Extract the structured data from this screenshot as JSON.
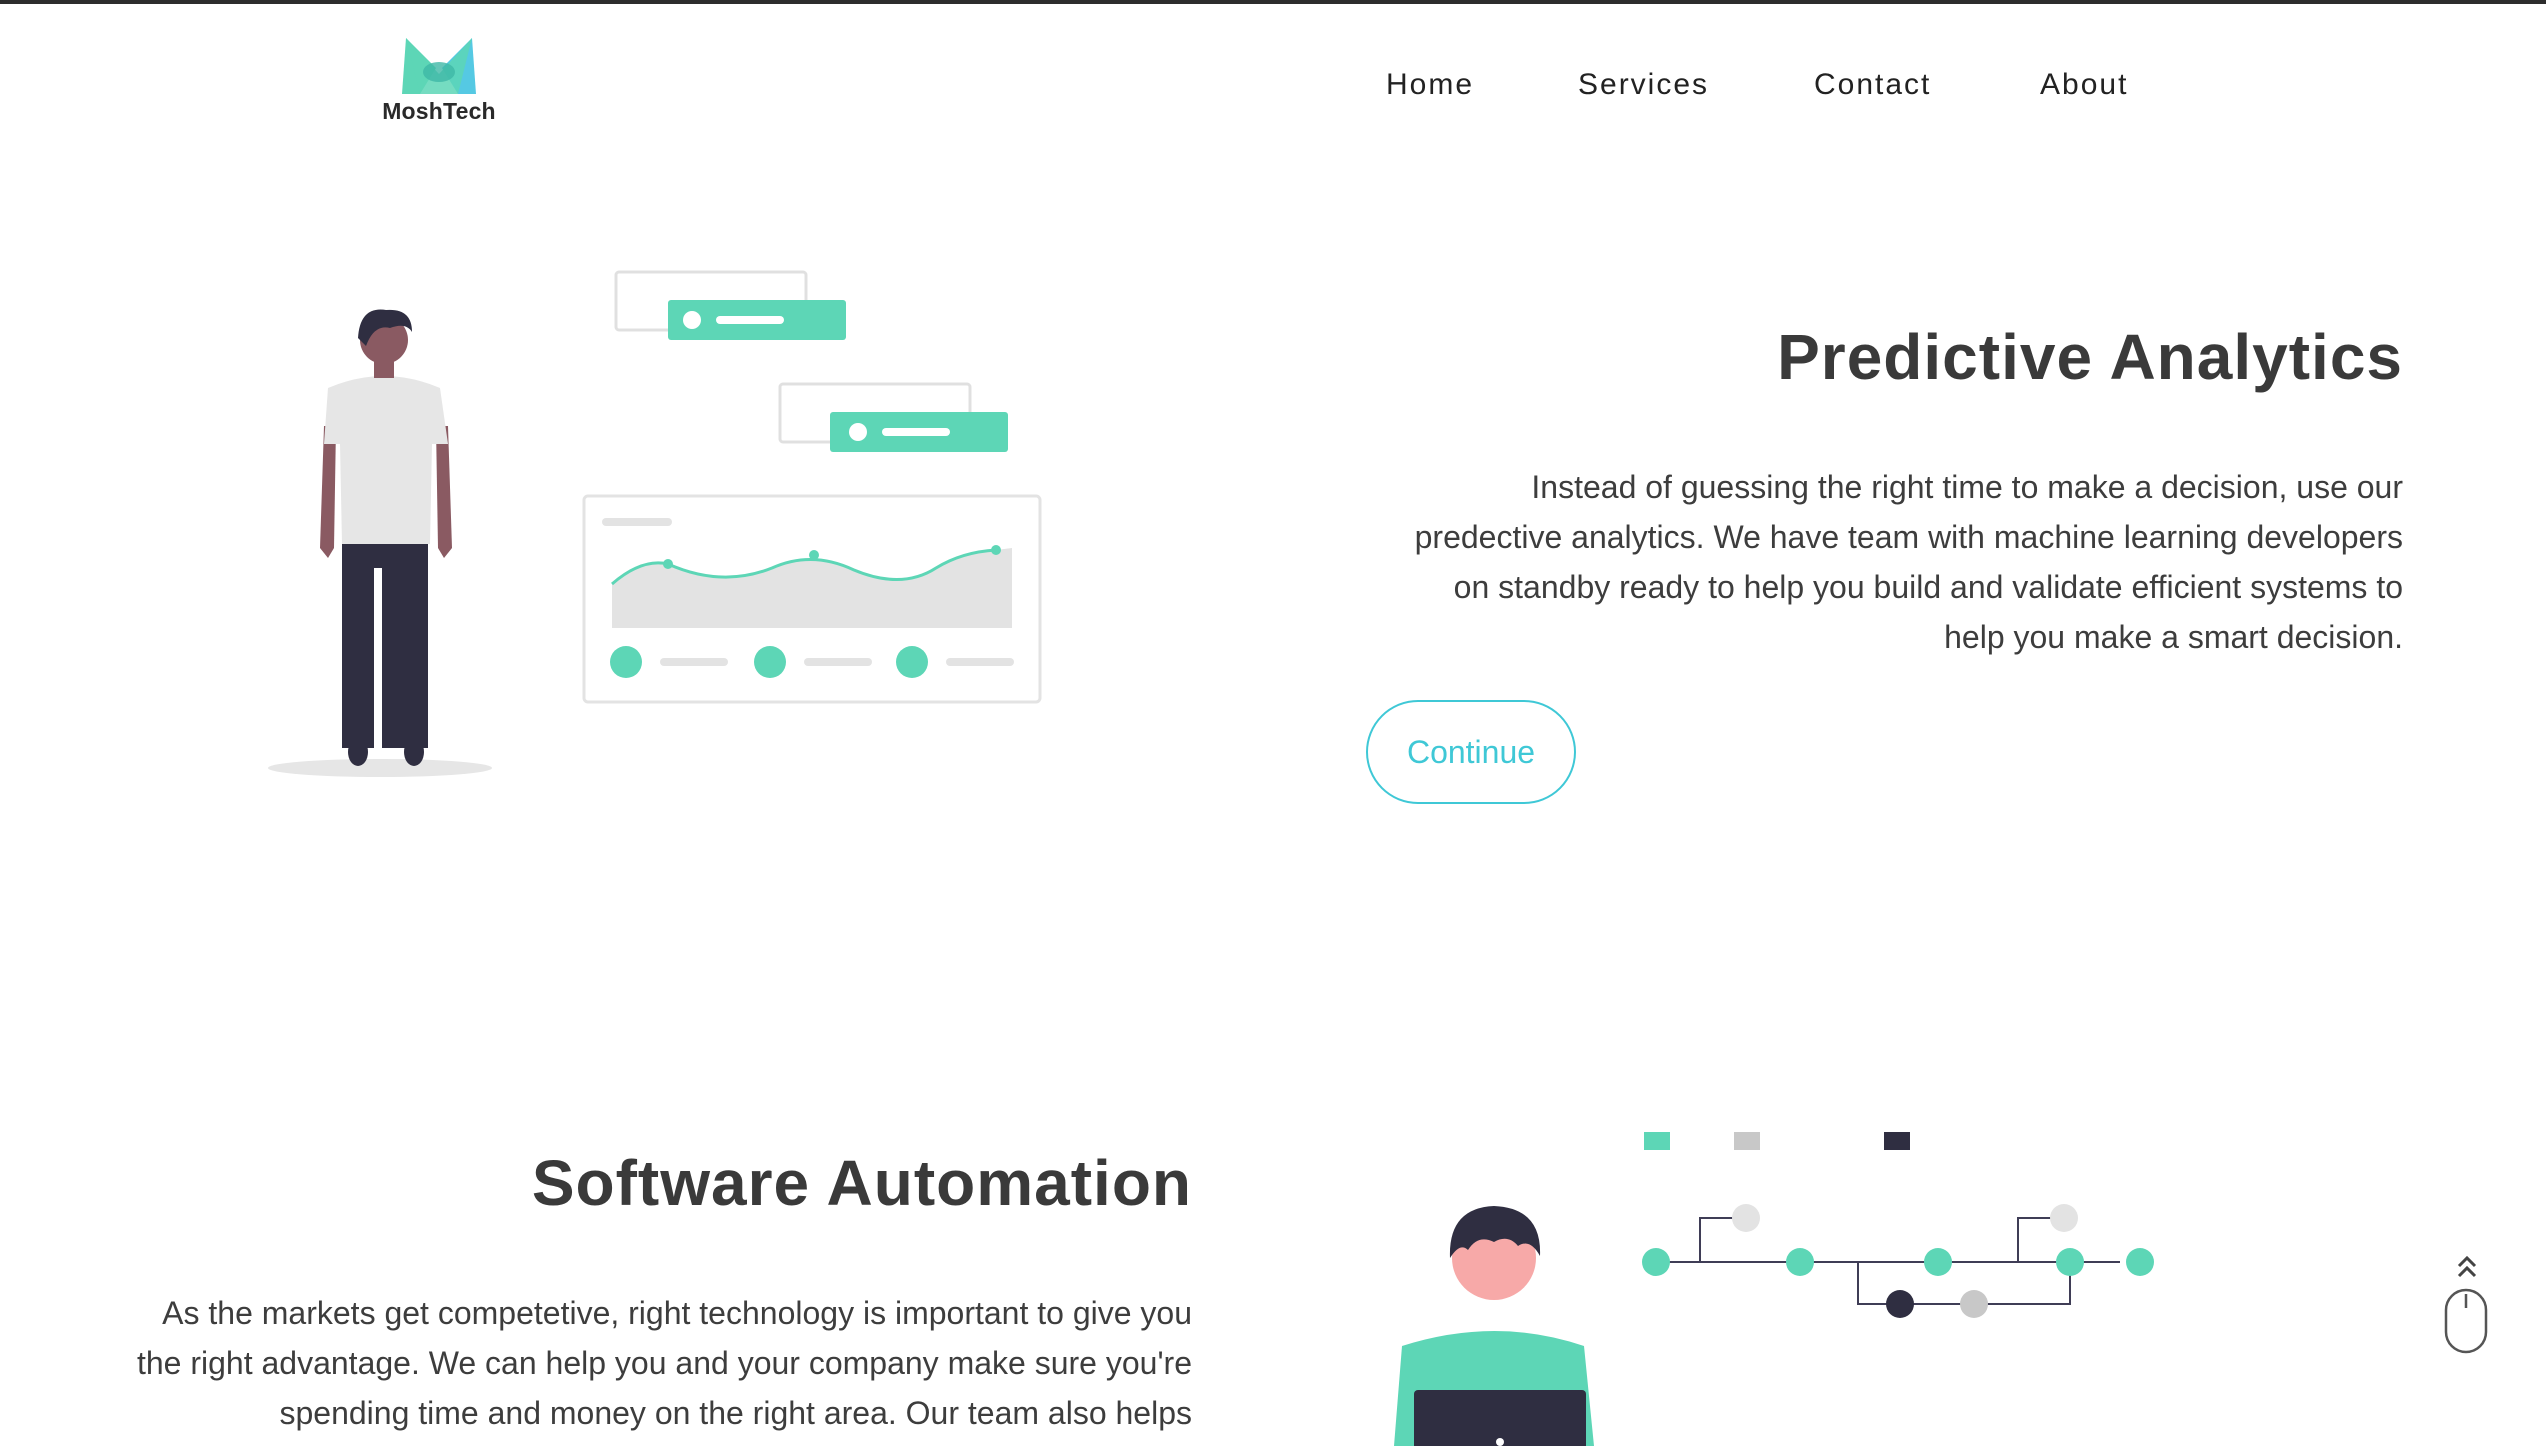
{
  "brand": {
    "name": "MoshTech",
    "colors": {
      "primary": "#5dd6b6",
      "secondary": "#55c9e3",
      "dark": "#2f2e41",
      "text": "#3a3a3a",
      "accent": "#3fc8d6"
    }
  },
  "nav": {
    "items": [
      {
        "label": "Home"
      },
      {
        "label": "Services"
      },
      {
        "label": "Contact"
      },
      {
        "label": "About"
      }
    ]
  },
  "sections": {
    "predictive": {
      "title": "Predictive Analytics",
      "body": "Instead of guessing the right time to make a decision, use our predective analytics. We have team with machine learning developers on standby ready to help you build and validate efficient systems to help you make a smart decision.",
      "button_label": "Continue"
    },
    "automation": {
      "title": "Software Automation",
      "body": "As the markets get competetive, right technology is important to give you the right advantage. We can help you and your company make sure you're spending time and money on the right area. Our team also helps"
    }
  },
  "icons": {
    "scroll_top": "double-chevron-up-icon",
    "mouse": "mouse-scroll-icon",
    "logo": "moshtech-logo-icon"
  }
}
